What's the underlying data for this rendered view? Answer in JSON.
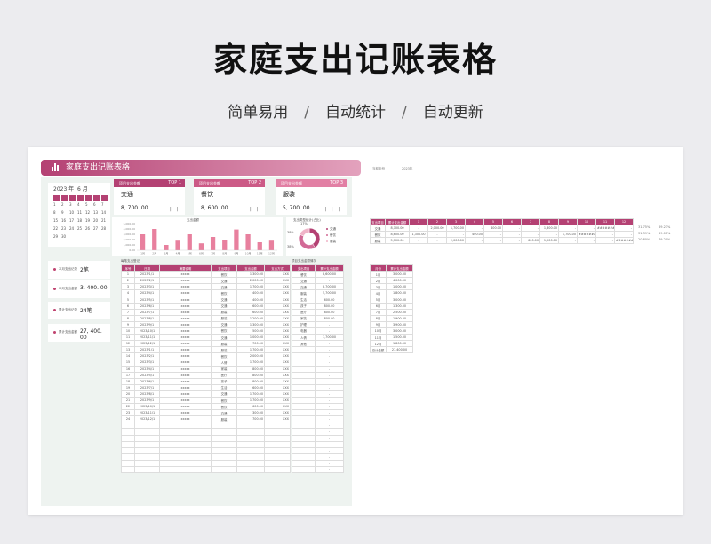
{
  "hero": {
    "title": "家庭支出记账表格",
    "features": [
      "简单易用",
      "自动统计",
      "自动更新"
    ],
    "separator": "/"
  },
  "sheet": {
    "banner_title": "家庭支出记账表格",
    "calendar": {
      "year_label": "2023 年",
      "month_label": "6 月",
      "rows": [
        [
          "1",
          "2",
          "3",
          "4",
          "5",
          "6",
          "7"
        ],
        [
          "8",
          "9",
          "10",
          "11",
          "12",
          "13",
          "14"
        ],
        [
          "15",
          "16",
          "17",
          "18",
          "19",
          "20",
          "21"
        ],
        [
          "22",
          "23",
          "24",
          "25",
          "26",
          "27",
          "28"
        ],
        [
          "29",
          "30",
          "",
          "",
          "",
          "",
          ""
        ]
      ]
    },
    "top_cards": [
      {
        "header": "项目支出金额",
        "rank": "TOP 1",
        "category": "交通",
        "amount": "8, 700. 00",
        "color": "#b44173"
      },
      {
        "header": "项目支出金额",
        "rank": "TOP 2",
        "category": "餐饮",
        "amount": "8, 600. 00",
        "color": "#cc5a86"
      },
      {
        "header": "项目支出金额",
        "rank": "TOP 3",
        "category": "服装",
        "amount": "5, 700. 00",
        "color": "#e27fa4"
      }
    ],
    "bar_chart": {
      "title": "支出金额",
      "chart_data": {
        "type": "bar",
        "categories": [
          "1月",
          "2月",
          "3月",
          "4月",
          "5月",
          "6月",
          "7月",
          "8月",
          "9月",
          "10月",
          "11月",
          "12月"
        ],
        "values": [
          3000,
          4000,
          1000,
          1800,
          3000,
          1300,
          2500,
          1900,
          3900,
          3000,
          1500,
          1800
        ],
        "ylim": [
          0,
          5000
        ],
        "ticks": [
          "5,000.00",
          "4,000.00",
          "3,000.00",
          "2,000.00",
          "1,000.00",
          "0.00"
        ]
      }
    },
    "donut_chart": {
      "title": "支出类型统计(占比)",
      "chart_data": {
        "type": "pie",
        "categories": [
          "交通",
          "餐饮",
          "服装"
        ],
        "labels": [
          "38%",
          "17%",
          "38%"
        ],
        "values": [
          38,
          38,
          17
        ],
        "colors": [
          "#b44173",
          "#d26a96",
          "#f0b4c8"
        ]
      }
    },
    "stats": [
      {
        "label": "本月支出记录",
        "value": "2笔"
      },
      {
        "label": "本月支出金额",
        "value": "3, 400. 00"
      },
      {
        "label": "累计支出记录",
        "value": "24笔"
      },
      {
        "label": "累计支出金额",
        "value": "27, 400. 00"
      }
    ],
    "detail_table": {
      "title": "每笔支出登记",
      "headers": [
        "序号",
        "日期",
        "摘要说明",
        "支出项目",
        "支出金额",
        "支出方式"
      ],
      "rows": [
        [
          "1",
          "2023/1/1",
          "xxxxx",
          "餐饮",
          "1,300.00",
          "XXX"
        ],
        [
          "2",
          "2023/2/1",
          "xxxxx",
          "交通",
          "2,000.00",
          "XXX"
        ],
        [
          "3",
          "2023/3/1",
          "xxxxx",
          "交通",
          "1,700.00",
          "XXX"
        ],
        [
          "4",
          "2023/4/1",
          "xxxxx",
          "餐饮",
          "400.00",
          "XXX"
        ],
        [
          "5",
          "2023/5/1",
          "xxxxx",
          "交通",
          "400.00",
          "XXX"
        ],
        [
          "6",
          "2023/6/1",
          "xxxxx",
          "交通",
          "600.00",
          "XXX"
        ],
        [
          "7",
          "2023/7/1",
          "xxxxx",
          "服装",
          "600.00",
          "XXX"
        ],
        [
          "8",
          "2023/8/1",
          "xxxxx",
          "服装",
          "1,200.00",
          "XXX"
        ],
        [
          "9",
          "2023/9/1",
          "xxxxx",
          "交通",
          "1,300.00",
          "XXX"
        ],
        [
          "10",
          "2023/10/1",
          "xxxxx",
          "餐饮",
          "500.00",
          "XXX"
        ],
        [
          "11",
          "2023/11/1",
          "xxxxx",
          "交通",
          "1,000.00",
          "XXX"
        ],
        [
          "12",
          "2023/12/1",
          "xxxxx",
          "服装",
          "700.00",
          "XXX"
        ],
        [
          "13",
          "2023/1/1",
          "xxxxx",
          "服装",
          "1,700.00",
          "XXX"
        ],
        [
          "14",
          "2023/2/1",
          "xxxxx",
          "餐饮",
          "2,000.00",
          "XXX"
        ],
        [
          "15",
          "2023/3/1",
          "xxxxx",
          "人情",
          "1,700.00",
          "XXX"
        ],
        [
          "16",
          "2023/4/1",
          "xxxxx",
          "家装",
          "800.00",
          "XXX"
        ],
        [
          "17",
          "2023/5/1",
          "xxxxx",
          "医疗",
          "800.00",
          "XXX"
        ],
        [
          "18",
          "2023/6/1",
          "xxxxx",
          "孩子",
          "800.00",
          "XXX"
        ],
        [
          "19",
          "2023/7/1",
          "xxxxx",
          "生活",
          "600.00",
          "XXX"
        ],
        [
          "20",
          "2023/8/1",
          "xxxxx",
          "交通",
          "1,700.00",
          "XXX"
        ],
        [
          "21",
          "2023/9/1",
          "xxxxx",
          "餐饮",
          "1,700.00",
          "XXX"
        ],
        [
          "22",
          "2023/10/1",
          "xxxxx",
          "餐饮",
          "600.00",
          "XXX"
        ],
        [
          "23",
          "2023/11/1",
          "xxxxx",
          "交通",
          "300.00",
          "XXX"
        ],
        [
          "24",
          "2023/12/1",
          "xxxxx",
          "服装",
          "700.00",
          "XXX"
        ],
        [
          "",
          "",
          "",
          "",
          "",
          ""
        ],
        [
          "",
          "",
          "",
          "",
          "",
          ""
        ],
        [
          "",
          "",
          "",
          "",
          "",
          ""
        ],
        [
          "",
          "",
          "",
          "",
          "",
          ""
        ],
        [
          "",
          "",
          "",
          "",
          "",
          ""
        ],
        [
          "",
          "",
          "",
          "",
          "",
          ""
        ],
        [
          "",
          "",
          "",
          "",
          "",
          ""
        ],
        [
          "",
          "",
          "",
          "",
          "",
          ""
        ]
      ]
    },
    "category_table": {
      "title": "项目支出金额情况",
      "headers": [
        "支出项目",
        "累计支出金额"
      ],
      "rows": [
        [
          "餐饮",
          "8,600.00"
        ],
        [
          "交通",
          "-"
        ],
        [
          "交通",
          "8,700.00"
        ],
        [
          "服装",
          "5,700.00"
        ],
        [
          "生活",
          "600.00"
        ],
        [
          "孩子",
          "800.00"
        ],
        [
          "医疗",
          "800.00"
        ],
        [
          "家装",
          "800.00"
        ],
        [
          "护理",
          "-"
        ],
        [
          "电器",
          "-"
        ],
        [
          "人情",
          "1,700.00"
        ],
        [
          "其他",
          "-"
        ],
        [
          "",
          "-"
        ],
        [
          "",
          "-"
        ],
        [
          "",
          "-"
        ],
        [
          "",
          "-"
        ],
        [
          "",
          "-"
        ],
        [
          "",
          "-"
        ],
        [
          "",
          "-"
        ],
        [
          "",
          "-"
        ],
        [
          "",
          "-"
        ],
        [
          "",
          "-"
        ],
        [
          "",
          "-"
        ],
        [
          "",
          "-"
        ],
        [
          "",
          "-"
        ],
        [
          "",
          "-"
        ],
        [
          "",
          "-"
        ],
        [
          "",
          "-"
        ],
        [
          "",
          "-"
        ],
        [
          "",
          "-"
        ],
        [
          "",
          "-"
        ],
        [
          "",
          "-"
        ]
      ]
    },
    "month_header_labels": {
      "current_year": "当前年份",
      "year_value": "2023年"
    },
    "matrix_table": {
      "headers": [
        "支出项目",
        "累计支出金额",
        "1",
        "2",
        "3",
        "4",
        "5",
        "6",
        "7",
        "8",
        "9",
        "10",
        "11",
        "12"
      ],
      "rows": [
        [
          "交通",
          "8,700.00",
          "-",
          "2,000.00",
          "1,700.00",
          "-",
          "400.00",
          "-",
          "-",
          "1,300.00",
          "-",
          "-",
          "########",
          "-"
        ],
        [
          "餐饮",
          "8,600.00",
          "1,300.00",
          "-",
          "-",
          "400.00",
          "-",
          "-",
          "-",
          "-",
          "1,700.00",
          "########",
          "-",
          "-"
        ],
        [
          "服装",
          "5,700.00",
          "-",
          "-",
          "2,000.00",
          "-",
          "-",
          "-",
          "600.00",
          "1,200.00",
          "-",
          "-",
          "-",
          "########"
        ]
      ],
      "side_values": [
        [
          "31.75%",
          "69.23%"
        ],
        [
          "31.39%",
          "69.01%"
        ],
        [
          "20.80%",
          "79.20%"
        ]
      ]
    },
    "monthly_table": {
      "headers": [
        "月份",
        "累计支出金额"
      ],
      "rows": [
        [
          "1月",
          "3,000.00"
        ],
        [
          "2月",
          "4,000.00"
        ],
        [
          "3月",
          "1,000.00"
        ],
        [
          "4月",
          "1,800.00"
        ],
        [
          "5月",
          "3,000.00"
        ],
        [
          "6月",
          "1,300.00"
        ],
        [
          "7月",
          "2,500.00"
        ],
        [
          "8月",
          "1,900.00"
        ],
        [
          "9月",
          "3,900.00"
        ],
        [
          "10月",
          "3,000.00"
        ],
        [
          "11月",
          "1,500.00"
        ],
        [
          "12月",
          "1,800.00"
        ],
        [
          "总计金额",
          "27,400.00"
        ]
      ]
    }
  }
}
